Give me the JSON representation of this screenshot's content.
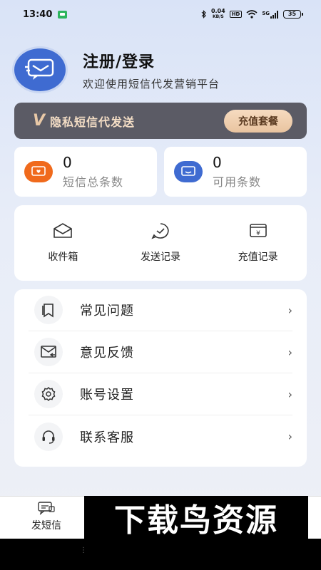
{
  "status_bar": {
    "time": "13:40",
    "speed_value": "0.04",
    "speed_unit": "KB/S",
    "hd": "HD",
    "network": "5G",
    "battery": "35"
  },
  "profile": {
    "title": "注册/登录",
    "subtitle": "欢迎使用短信代发营销平台"
  },
  "vip": {
    "logo": "V",
    "text": "隐私短信代发送",
    "button": "充值套餐",
    "colors": {
      "bg": "#5b5b65",
      "accent": "#e9c4a0"
    }
  },
  "stats": [
    {
      "value": "0",
      "label": "短信总条数",
      "icon": "message-heart-icon",
      "color": "#f06a1c"
    },
    {
      "value": "0",
      "label": "可用条数",
      "icon": "message-chat-icon",
      "color": "#3f6bd1"
    }
  ],
  "quick_actions": [
    {
      "label": "收件箱",
      "icon": "inbox-envelope-icon"
    },
    {
      "label": "发送记录",
      "icon": "send-check-icon"
    },
    {
      "label": "充值记录",
      "icon": "recharge-yen-icon"
    }
  ],
  "menu": [
    {
      "label": "常见问题",
      "icon": "faq-book-icon",
      "arrow": "›"
    },
    {
      "label": "意见反馈",
      "icon": "feedback-mail-icon",
      "arrow": "›"
    },
    {
      "label": "账号设置",
      "icon": "gear-icon",
      "arrow": "›"
    },
    {
      "label": "联系客服",
      "icon": "headset-icon",
      "arrow": "›"
    }
  ],
  "tabbar": {
    "items": [
      {
        "label": "发短信",
        "icon": "sms-chat-icon"
      }
    ]
  },
  "watermark": "下载鸟资源"
}
